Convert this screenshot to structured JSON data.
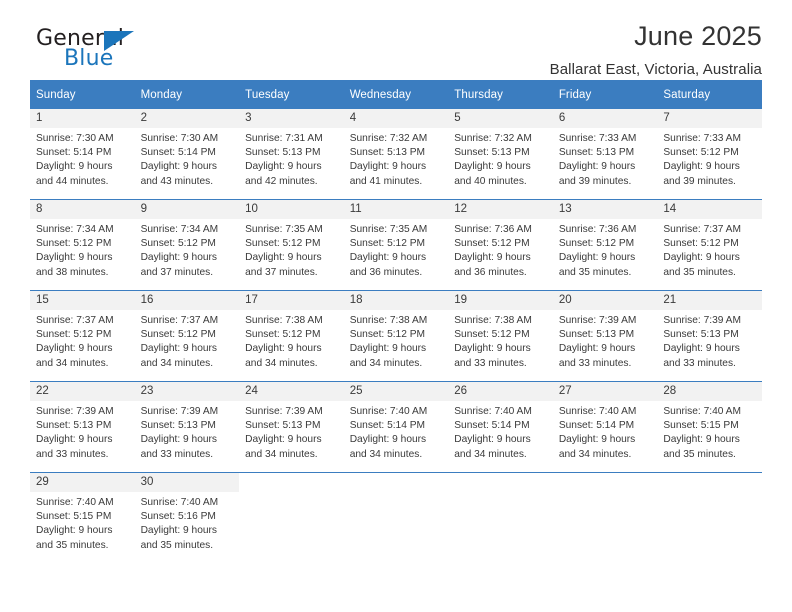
{
  "brand": {
    "name_top": "General",
    "name_bottom": "Blue",
    "accent_color": "#1b75bb"
  },
  "header": {
    "title": "June 2025",
    "location": "Ballarat East, Victoria, Australia"
  },
  "theme": {
    "header_row_bg": "#3b7dc0",
    "daynum_bg": "#f2f2f2",
    "text_color": "#3a3a3a"
  },
  "weekday_headers": [
    "Sunday",
    "Monday",
    "Tuesday",
    "Wednesday",
    "Thursday",
    "Friday",
    "Saturday"
  ],
  "weeks": [
    [
      {
        "day": "1",
        "sunrise": "Sunrise: 7:30 AM",
        "sunset": "Sunset: 5:14 PM",
        "daylight1": "Daylight: 9 hours",
        "daylight2": "and 44 minutes."
      },
      {
        "day": "2",
        "sunrise": "Sunrise: 7:30 AM",
        "sunset": "Sunset: 5:14 PM",
        "daylight1": "Daylight: 9 hours",
        "daylight2": "and 43 minutes."
      },
      {
        "day": "3",
        "sunrise": "Sunrise: 7:31 AM",
        "sunset": "Sunset: 5:13 PM",
        "daylight1": "Daylight: 9 hours",
        "daylight2": "and 42 minutes."
      },
      {
        "day": "4",
        "sunrise": "Sunrise: 7:32 AM",
        "sunset": "Sunset: 5:13 PM",
        "daylight1": "Daylight: 9 hours",
        "daylight2": "and 41 minutes."
      },
      {
        "day": "5",
        "sunrise": "Sunrise: 7:32 AM",
        "sunset": "Sunset: 5:13 PM",
        "daylight1": "Daylight: 9 hours",
        "daylight2": "and 40 minutes."
      },
      {
        "day": "6",
        "sunrise": "Sunrise: 7:33 AM",
        "sunset": "Sunset: 5:13 PM",
        "daylight1": "Daylight: 9 hours",
        "daylight2": "and 39 minutes."
      },
      {
        "day": "7",
        "sunrise": "Sunrise: 7:33 AM",
        "sunset": "Sunset: 5:12 PM",
        "daylight1": "Daylight: 9 hours",
        "daylight2": "and 39 minutes."
      }
    ],
    [
      {
        "day": "8",
        "sunrise": "Sunrise: 7:34 AM",
        "sunset": "Sunset: 5:12 PM",
        "daylight1": "Daylight: 9 hours",
        "daylight2": "and 38 minutes."
      },
      {
        "day": "9",
        "sunrise": "Sunrise: 7:34 AM",
        "sunset": "Sunset: 5:12 PM",
        "daylight1": "Daylight: 9 hours",
        "daylight2": "and 37 minutes."
      },
      {
        "day": "10",
        "sunrise": "Sunrise: 7:35 AM",
        "sunset": "Sunset: 5:12 PM",
        "daylight1": "Daylight: 9 hours",
        "daylight2": "and 37 minutes."
      },
      {
        "day": "11",
        "sunrise": "Sunrise: 7:35 AM",
        "sunset": "Sunset: 5:12 PM",
        "daylight1": "Daylight: 9 hours",
        "daylight2": "and 36 minutes."
      },
      {
        "day": "12",
        "sunrise": "Sunrise: 7:36 AM",
        "sunset": "Sunset: 5:12 PM",
        "daylight1": "Daylight: 9 hours",
        "daylight2": "and 36 minutes."
      },
      {
        "day": "13",
        "sunrise": "Sunrise: 7:36 AM",
        "sunset": "Sunset: 5:12 PM",
        "daylight1": "Daylight: 9 hours",
        "daylight2": "and 35 minutes."
      },
      {
        "day": "14",
        "sunrise": "Sunrise: 7:37 AM",
        "sunset": "Sunset: 5:12 PM",
        "daylight1": "Daylight: 9 hours",
        "daylight2": "and 35 minutes."
      }
    ],
    [
      {
        "day": "15",
        "sunrise": "Sunrise: 7:37 AM",
        "sunset": "Sunset: 5:12 PM",
        "daylight1": "Daylight: 9 hours",
        "daylight2": "and 34 minutes."
      },
      {
        "day": "16",
        "sunrise": "Sunrise: 7:37 AM",
        "sunset": "Sunset: 5:12 PM",
        "daylight1": "Daylight: 9 hours",
        "daylight2": "and 34 minutes."
      },
      {
        "day": "17",
        "sunrise": "Sunrise: 7:38 AM",
        "sunset": "Sunset: 5:12 PM",
        "daylight1": "Daylight: 9 hours",
        "daylight2": "and 34 minutes."
      },
      {
        "day": "18",
        "sunrise": "Sunrise: 7:38 AM",
        "sunset": "Sunset: 5:12 PM",
        "daylight1": "Daylight: 9 hours",
        "daylight2": "and 34 minutes."
      },
      {
        "day": "19",
        "sunrise": "Sunrise: 7:38 AM",
        "sunset": "Sunset: 5:12 PM",
        "daylight1": "Daylight: 9 hours",
        "daylight2": "and 33 minutes."
      },
      {
        "day": "20",
        "sunrise": "Sunrise: 7:39 AM",
        "sunset": "Sunset: 5:13 PM",
        "daylight1": "Daylight: 9 hours",
        "daylight2": "and 33 minutes."
      },
      {
        "day": "21",
        "sunrise": "Sunrise: 7:39 AM",
        "sunset": "Sunset: 5:13 PM",
        "daylight1": "Daylight: 9 hours",
        "daylight2": "and 33 minutes."
      }
    ],
    [
      {
        "day": "22",
        "sunrise": "Sunrise: 7:39 AM",
        "sunset": "Sunset: 5:13 PM",
        "daylight1": "Daylight: 9 hours",
        "daylight2": "and 33 minutes."
      },
      {
        "day": "23",
        "sunrise": "Sunrise: 7:39 AM",
        "sunset": "Sunset: 5:13 PM",
        "daylight1": "Daylight: 9 hours",
        "daylight2": "and 33 minutes."
      },
      {
        "day": "24",
        "sunrise": "Sunrise: 7:39 AM",
        "sunset": "Sunset: 5:13 PM",
        "daylight1": "Daylight: 9 hours",
        "daylight2": "and 34 minutes."
      },
      {
        "day": "25",
        "sunrise": "Sunrise: 7:40 AM",
        "sunset": "Sunset: 5:14 PM",
        "daylight1": "Daylight: 9 hours",
        "daylight2": "and 34 minutes."
      },
      {
        "day": "26",
        "sunrise": "Sunrise: 7:40 AM",
        "sunset": "Sunset: 5:14 PM",
        "daylight1": "Daylight: 9 hours",
        "daylight2": "and 34 minutes."
      },
      {
        "day": "27",
        "sunrise": "Sunrise: 7:40 AM",
        "sunset": "Sunset: 5:14 PM",
        "daylight1": "Daylight: 9 hours",
        "daylight2": "and 34 minutes."
      },
      {
        "day": "28",
        "sunrise": "Sunrise: 7:40 AM",
        "sunset": "Sunset: 5:15 PM",
        "daylight1": "Daylight: 9 hours",
        "daylight2": "and 35 minutes."
      }
    ],
    [
      {
        "day": "29",
        "sunrise": "Sunrise: 7:40 AM",
        "sunset": "Sunset: 5:15 PM",
        "daylight1": "Daylight: 9 hours",
        "daylight2": "and 35 minutes."
      },
      {
        "day": "30",
        "sunrise": "Sunrise: 7:40 AM",
        "sunset": "Sunset: 5:16 PM",
        "daylight1": "Daylight: 9 hours",
        "daylight2": "and 35 minutes."
      },
      {
        "day": "",
        "sunrise": "",
        "sunset": "",
        "daylight1": "",
        "daylight2": ""
      },
      {
        "day": "",
        "sunrise": "",
        "sunset": "",
        "daylight1": "",
        "daylight2": ""
      },
      {
        "day": "",
        "sunrise": "",
        "sunset": "",
        "daylight1": "",
        "daylight2": ""
      },
      {
        "day": "",
        "sunrise": "",
        "sunset": "",
        "daylight1": "",
        "daylight2": ""
      },
      {
        "day": "",
        "sunrise": "",
        "sunset": "",
        "daylight1": "",
        "daylight2": ""
      }
    ]
  ]
}
